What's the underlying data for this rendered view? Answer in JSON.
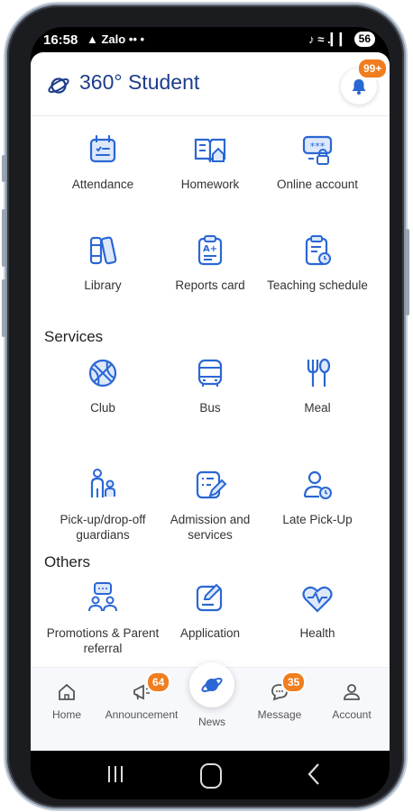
{
  "status": {
    "time": "16:58",
    "left_icons": "▲ Zalo •• •",
    "right_icons": "♪ ≈ .▎▎",
    "battery": "56"
  },
  "header": {
    "title": "360° Student",
    "notification_badge": "99+"
  },
  "colors": {
    "accent": "#2a67d4",
    "badge": "#f07d1e",
    "title": "#1d3d8a"
  },
  "tiles_top": [
    {
      "label": "Attendance",
      "icon": "calendar-check-icon"
    },
    {
      "label": "Homework",
      "icon": "book-home-icon"
    },
    {
      "label": "Online account",
      "icon": "password-lock-icon"
    },
    {
      "label": "Library",
      "icon": "books-icon"
    },
    {
      "label": "Reports card",
      "icon": "clipboard-grade-icon"
    },
    {
      "label": "Teaching schedule",
      "icon": "clipboard-clock-icon"
    }
  ],
  "services": {
    "title": "Services",
    "items": [
      {
        "label": "Club",
        "icon": "basketball-icon"
      },
      {
        "label": "Bus",
        "icon": "bus-icon"
      },
      {
        "label": "Meal",
        "icon": "fork-spoon-icon"
      },
      {
        "label": "Pick-up/drop-off guardians",
        "icon": "guardian-child-icon"
      },
      {
        "label": "Admission and services",
        "icon": "edit-list-icon"
      },
      {
        "label": "Late Pick-Up",
        "icon": "person-clock-icon"
      }
    ]
  },
  "others": {
    "title": "Others",
    "items": [
      {
        "label": "Promotions & Parent referral",
        "icon": "people-chat-icon"
      },
      {
        "label": "Application",
        "icon": "edit-note-icon"
      },
      {
        "label": "Health",
        "icon": "heart-pulse-icon"
      }
    ]
  },
  "nav": {
    "home": "Home",
    "announcement": "Announcement",
    "announcement_badge": "64",
    "news": "News",
    "message": "Message",
    "message_badge": "35",
    "account": "Account"
  }
}
